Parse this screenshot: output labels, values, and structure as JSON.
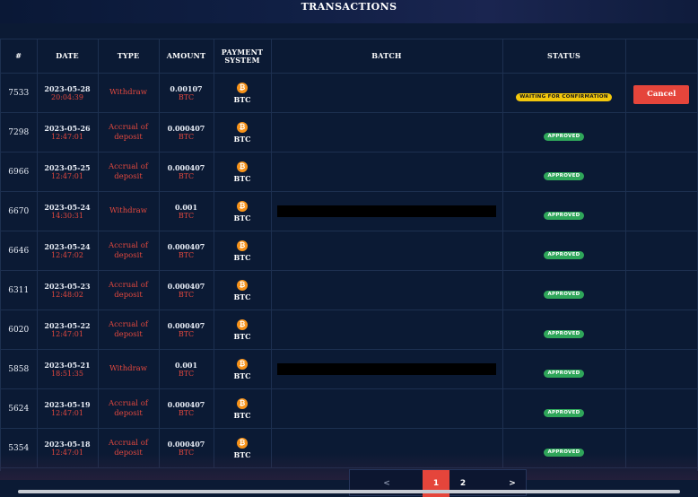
{
  "page": {
    "title": "TRANSACTIONS"
  },
  "table": {
    "headers": {
      "num": "#",
      "date": "DATE",
      "type": "TYPE",
      "amount": "AMOUNT",
      "payment_line1": "PAYMENT",
      "payment_line2": "SYSTEM",
      "batch": "BATCH",
      "status": "STATUS"
    },
    "rows": [
      {
        "id": "7533",
        "date": "2023-05-28",
        "time": "20:04:39",
        "type_l1": "Withdraw",
        "type_l2": "",
        "amount": "0.00107",
        "currency": "BTC",
        "payment": "BTC",
        "batch_redacted": false,
        "status": "WAITING FOR CONFIRMATION",
        "status_kind": "waiting",
        "action": "Cancel"
      },
      {
        "id": "7298",
        "date": "2023-05-26",
        "time": "12:47:01",
        "type_l1": "Accrual of",
        "type_l2": "deposit",
        "amount": "0.000407",
        "currency": "BTC",
        "payment": "BTC",
        "batch_redacted": false,
        "status": "APPROVED",
        "status_kind": "approved",
        "action": ""
      },
      {
        "id": "6966",
        "date": "2023-05-25",
        "time": "12:47:01",
        "type_l1": "Accrual of",
        "type_l2": "deposit",
        "amount": "0.000407",
        "currency": "BTC",
        "payment": "BTC",
        "batch_redacted": false,
        "status": "APPROVED",
        "status_kind": "approved",
        "action": ""
      },
      {
        "id": "6670",
        "date": "2023-05-24",
        "time": "14:30:31",
        "type_l1": "Withdraw",
        "type_l2": "",
        "amount": "0.001",
        "currency": "BTC",
        "payment": "BTC",
        "batch_redacted": true,
        "status": "APPROVED",
        "status_kind": "approved",
        "action": ""
      },
      {
        "id": "6646",
        "date": "2023-05-24",
        "time": "12:47:02",
        "type_l1": "Accrual of",
        "type_l2": "deposit",
        "amount": "0.000407",
        "currency": "BTC",
        "payment": "BTC",
        "batch_redacted": false,
        "status": "APPROVED",
        "status_kind": "approved",
        "action": ""
      },
      {
        "id": "6311",
        "date": "2023-05-23",
        "time": "12:48:02",
        "type_l1": "Accrual of",
        "type_l2": "deposit",
        "amount": "0.000407",
        "currency": "BTC",
        "payment": "BTC",
        "batch_redacted": false,
        "status": "APPROVED",
        "status_kind": "approved",
        "action": ""
      },
      {
        "id": "6020",
        "date": "2023-05-22",
        "time": "12:47:01",
        "type_l1": "Accrual of",
        "type_l2": "deposit",
        "amount": "0.000407",
        "currency": "BTC",
        "payment": "BTC",
        "batch_redacted": false,
        "status": "APPROVED",
        "status_kind": "approved",
        "action": ""
      },
      {
        "id": "5858",
        "date": "2023-05-21",
        "time": "18:51:35",
        "type_l1": "Withdraw",
        "type_l2": "",
        "amount": "0.001",
        "currency": "BTC",
        "payment": "BTC",
        "batch_redacted": true,
        "status": "APPROVED",
        "status_kind": "approved",
        "action": ""
      },
      {
        "id": "5624",
        "date": "2023-05-19",
        "time": "12:47:01",
        "type_l1": "Accrual of",
        "type_l2": "deposit",
        "amount": "0.000407",
        "currency": "BTC",
        "payment": "BTC",
        "batch_redacted": false,
        "status": "APPROVED",
        "status_kind": "approved",
        "action": ""
      },
      {
        "id": "5354",
        "date": "2023-05-18",
        "time": "12:47:01",
        "type_l1": "Accrual of",
        "type_l2": "deposit",
        "amount": "0.000407",
        "currency": "BTC",
        "payment": "BTC",
        "batch_redacted": false,
        "status": "APPROVED",
        "status_kind": "approved",
        "action": ""
      }
    ]
  },
  "icons": {
    "payment": "bitcoin-icon",
    "bitcoin_glyph": "₿"
  },
  "colors": {
    "accent": "#e5453b",
    "approved": "#2fa65a",
    "waiting": "#f2c70c",
    "bitcoin": "#f7931a"
  },
  "pagination": {
    "prev": "<",
    "pages": [
      "1",
      "2"
    ],
    "current": "1",
    "next": ">"
  }
}
